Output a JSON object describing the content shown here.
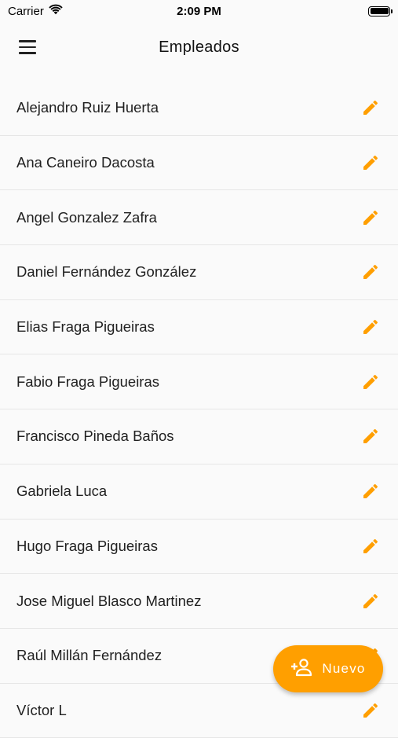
{
  "status_bar": {
    "carrier": "Carrier",
    "time": "2:09 PM",
    "wifi_icon": "wifi-icon",
    "battery_icon": "battery-full-icon"
  },
  "app_bar": {
    "title": "Empleados",
    "menu_icon": "hamburger-menu-icon"
  },
  "colors": {
    "accent": "#ff9f00",
    "background": "#fafafa",
    "divider": "#e6e6e6",
    "text": "#212121"
  },
  "employees": [
    {
      "name": "Alejandro Ruiz Huerta"
    },
    {
      "name": "Ana Caneiro Dacosta"
    },
    {
      "name": "Angel Gonzalez Zafra"
    },
    {
      "name": "Daniel Fernández González"
    },
    {
      "name": "Elias Fraga Pigueiras"
    },
    {
      "name": "Fabio Fraga Pigueiras"
    },
    {
      "name": "Francisco Pineda Baños"
    },
    {
      "name": "Gabriela Luca"
    },
    {
      "name": "Hugo Fraga Pigueiras"
    },
    {
      "name": "Jose Miguel Blasco Martinez"
    },
    {
      "name": "Raúl Millán Fernández"
    },
    {
      "name": "Víctor L"
    }
  ],
  "row_action_icon": "pencil-edit-icon",
  "fab": {
    "label": "Nuevo",
    "icon": "person-add-icon"
  }
}
